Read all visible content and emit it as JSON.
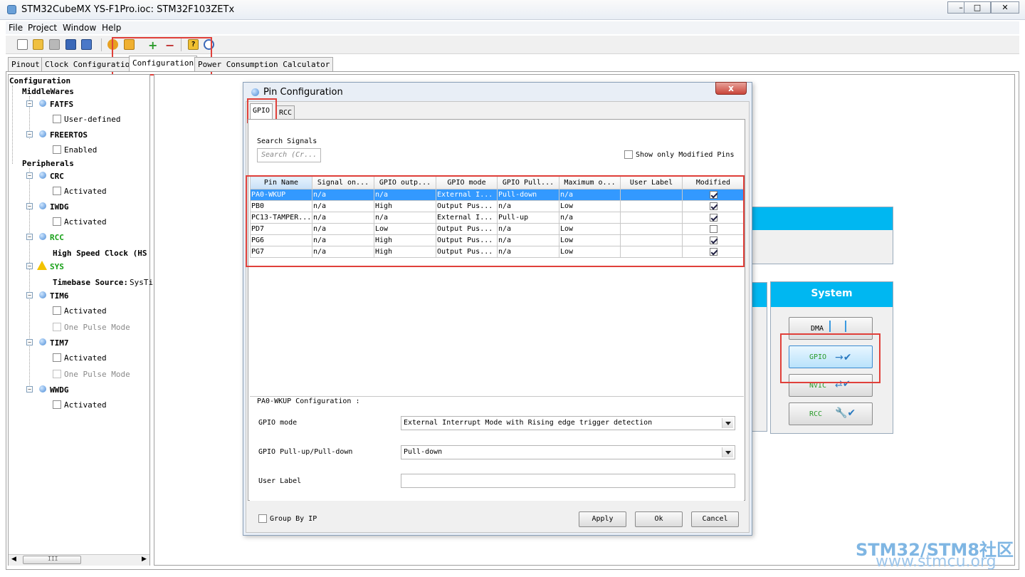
{
  "app": {
    "title": "STM32CubeMX YS-F1Pro.ioc: STM32F103ZETx",
    "window_buttons": [
      "–",
      "□",
      "✕"
    ]
  },
  "menu": [
    "File",
    "Project",
    "Window",
    "Help"
  ],
  "main_tabs": [
    "Pinout",
    "Clock Configuration",
    "Configuration",
    "Power Consumption Calculator"
  ],
  "tree": {
    "root": "Configuration",
    "middlewares": "MiddleWares",
    "fatfs": "FATFS",
    "fatfs_opt": "User-defined",
    "freertos": "FREERTOS",
    "freertos_opt": "Enabled",
    "peripherals": "Peripherals",
    "crc": "CRC",
    "crc_opt": "Activated",
    "iwdg": "IWDG",
    "iwdg_opt": "Activated",
    "rcc": "RCC",
    "rcc_opt": "High Speed Clock (HS",
    "sys": "SYS",
    "sys_opt_label": "Timebase Source:",
    "sys_opt_value": "SysTi",
    "tim6": "TIM6",
    "tim6_opt1": "Activated",
    "tim6_opt2": "One Pulse Mode",
    "tim7": "TIM7",
    "tim7_opt1": "Activated",
    "tim7_opt2": "One Pulse Mode",
    "wwdg": "WWDG",
    "wwdg_opt": "Activated",
    "scroll_thumb": "III"
  },
  "content": {
    "system_header": "System",
    "buttons": [
      "DMA",
      "GPIO",
      "NVIC",
      "RCC"
    ]
  },
  "dialog": {
    "title": "Pin Configuration",
    "close": "x",
    "tabs": [
      "GPIO",
      "RCC"
    ],
    "search_label": "Search Signals",
    "search_placeholder": "Search (Cr...",
    "show_modified": "Show only Modified Pins",
    "columns": [
      "Pin Name",
      "Signal on...",
      "GPIO outp...",
      "GPIO mode",
      "GPIO Pull...",
      "Maximum o...",
      "User Label",
      "Modified"
    ],
    "rows": [
      {
        "pin": "PA0-WKUP",
        "signal": "n/a",
        "output": "n/a",
        "mode": "External I...",
        "pull": "Pull-down",
        "speed": "n/a",
        "label": "",
        "modified": true
      },
      {
        "pin": "PB0",
        "signal": "n/a",
        "output": "High",
        "mode": "Output Pus...",
        "pull": "n/a",
        "speed": "Low",
        "label": "",
        "modified": true
      },
      {
        "pin": "PC13-TAMPER...",
        "signal": "n/a",
        "output": "n/a",
        "mode": "External I...",
        "pull": "Pull-up",
        "speed": "n/a",
        "label": "",
        "modified": true
      },
      {
        "pin": "PD7",
        "signal": "n/a",
        "output": "Low",
        "mode": "Output Pus...",
        "pull": "n/a",
        "speed": "Low",
        "label": "",
        "modified": false
      },
      {
        "pin": "PG6",
        "signal": "n/a",
        "output": "High",
        "mode": "Output Pus...",
        "pull": "n/a",
        "speed": "Low",
        "label": "",
        "modified": true
      },
      {
        "pin": "PG7",
        "signal": "n/a",
        "output": "High",
        "mode": "Output Pus...",
        "pull": "n/a",
        "speed": "Low",
        "label": "",
        "modified": true
      }
    ],
    "config_title": "PA0-WKUP Configuration :",
    "gpio_mode_label": "GPIO mode",
    "gpio_mode_value": "External Interrupt Mode with Rising edge trigger detection",
    "pull_label": "GPIO Pull-up/Pull-down",
    "pull_value": "Pull-down",
    "user_label_label": "User Label",
    "user_label_value": "",
    "group_by_ip": "Group By IP",
    "apply": "Apply",
    "ok": "Ok",
    "cancel": "Cancel"
  },
  "watermark": {
    "brand": "STM32/STM8社区",
    "url": "www.stmcu.org"
  },
  "colors": {
    "accent_cyan": "#00b7f1",
    "selection_blue": "#3399ff",
    "highlight_red": "#e0403a",
    "status_green": "#18a018"
  }
}
